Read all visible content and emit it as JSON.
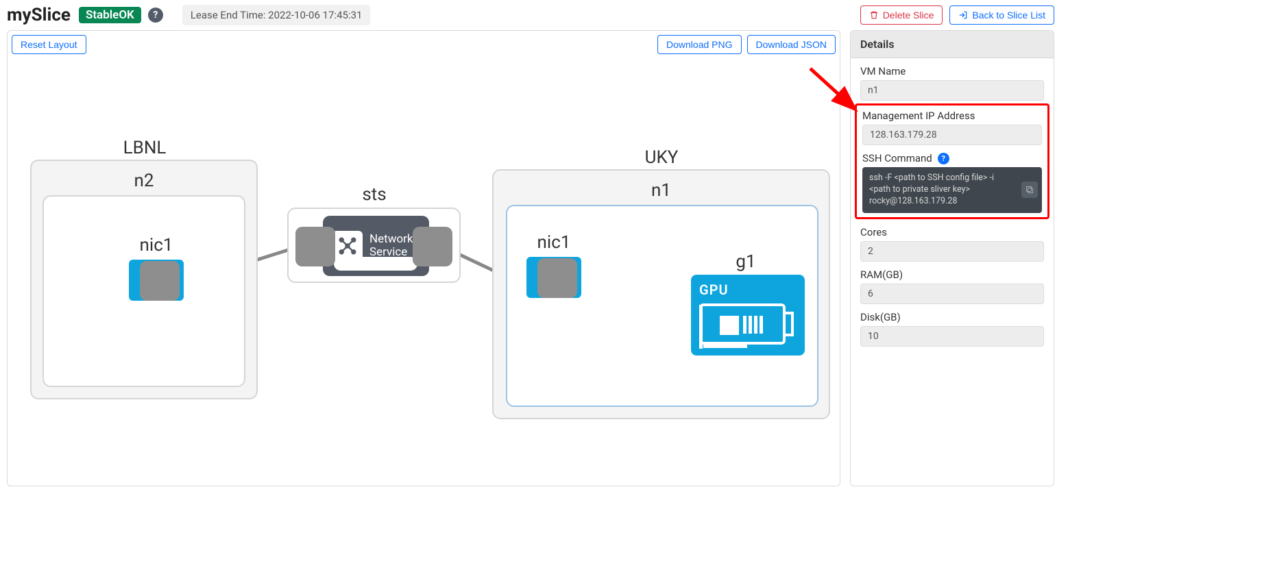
{
  "header": {
    "title": "mySlice",
    "status_badge": "StableOK",
    "lease_text": "Lease End Time: 2022-10-06 17:45:31",
    "delete_button": "Delete Slice",
    "back_button": "Back to Slice List"
  },
  "canvas": {
    "reset_button": "Reset Layout",
    "download_png": "Download PNG",
    "download_json": "Download JSON",
    "sites": {
      "lbnl": {
        "label": "LBNL",
        "vm": {
          "label": "n2",
          "nic": "nic1"
        }
      },
      "uky": {
        "label": "UKY",
        "vm": {
          "label": "n1",
          "nic": "nic1",
          "gpu_label": "g1",
          "gpu_text": "GPU"
        }
      }
    },
    "network_service": {
      "label": "sts",
      "text_line1": "Network",
      "text_line2": "Service"
    }
  },
  "details": {
    "panel_title": "Details",
    "fields": {
      "vm_name_label": "VM Name",
      "vm_name_value": "n1",
      "ip_label": "Management IP Address",
      "ip_value": "128.163.179.28",
      "ssh_label": "SSH Command",
      "ssh_value": "ssh -F <path to SSH config file> -i <path to private sliver key> rocky@128.163.179.28",
      "cores_label": "Cores",
      "cores_value": "2",
      "ram_label": "RAM(GB)",
      "ram_value": "6",
      "disk_label": "Disk(GB)",
      "disk_value": "10"
    }
  }
}
